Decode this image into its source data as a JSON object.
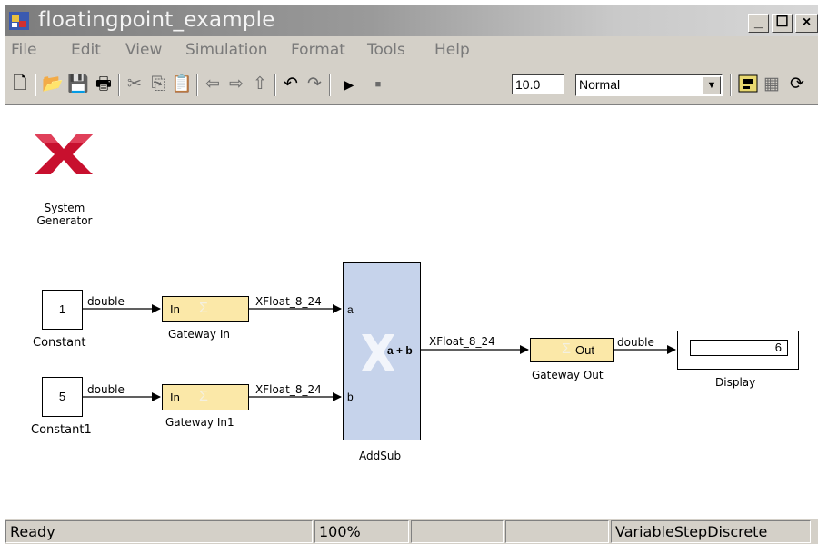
{
  "window": {
    "title": "floatingpoint_example"
  },
  "menu": [
    "File",
    "Edit",
    "View",
    "Simulation",
    "Format",
    "Tools",
    "Help"
  ],
  "toolbar": {
    "stop_time": "10.0",
    "sim_mode": "Normal"
  },
  "model": {
    "logo_label_line1": "System",
    "logo_label_line2": "Generator",
    "constant": {
      "value": "1",
      "label": "Constant"
    },
    "constant1": {
      "value": "5",
      "label": "Constant1"
    },
    "gateway_in": {
      "port": "In",
      "label": "Gateway In"
    },
    "gateway_in1": {
      "port": "In",
      "label": "Gateway In1"
    },
    "addsub": {
      "op": "a + b",
      "port_a": "a",
      "port_b": "b",
      "label": "AddSub"
    },
    "gateway_out": {
      "port": "Out",
      "label": "Gateway Out"
    },
    "display": {
      "value": "6",
      "label": "Display"
    },
    "signals": {
      "c_to_gw": "double",
      "c1_to_gw1": "double",
      "gw_to_add": "XFloat_8_24",
      "gw1_to_add": "XFloat_8_24",
      "add_to_out": "XFloat_8_24",
      "out_to_disp": "double"
    }
  },
  "status": {
    "state": "Ready",
    "zoom": "100%",
    "solver": "VariableStepDiscrete"
  },
  "colors": {
    "gateway_fill": "#fbe8a8",
    "addsub_fill": "#c6d3eb",
    "logo_red": "#c8102e"
  }
}
